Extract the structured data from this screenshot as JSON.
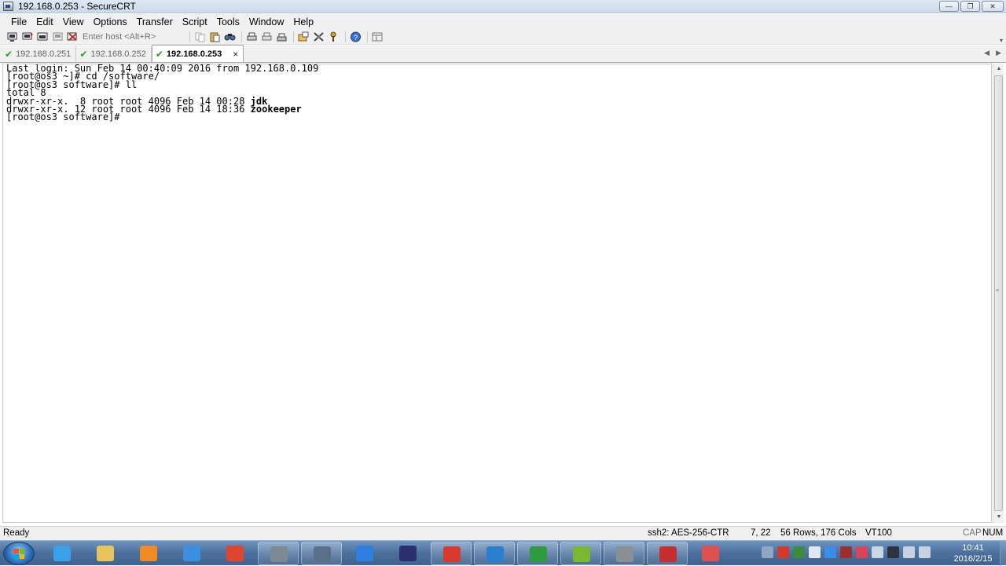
{
  "window": {
    "title": "192.168.0.253 - SecureCRT",
    "controls": {
      "minimize": "—",
      "maximize": "❐",
      "close": "✕"
    }
  },
  "menu": [
    "File",
    "Edit",
    "View",
    "Options",
    "Transfer",
    "Script",
    "Tools",
    "Window",
    "Help"
  ],
  "toolbar": {
    "host_placeholder": "Enter host <Alt+R>"
  },
  "tabs": [
    {
      "label": "192.168.0.251",
      "active": false
    },
    {
      "label": "192.168.0.252",
      "active": false
    },
    {
      "label": "192.168.0.253",
      "active": true,
      "close": "×"
    }
  ],
  "tab_arrows": {
    "left": "◀",
    "right": "▶"
  },
  "terminal": {
    "lines": [
      "Last login: Sun Feb 14 00:40:09 2016 from 192.168.0.109",
      "[root@os3 ~]# cd /software/",
      "[root@os3 software]# ll",
      "total 8"
    ],
    "listing": [
      {
        "prefix": "drwxr-xr-x.  8 root root 4096 Feb 14 00:28 ",
        "name": "jdk"
      },
      {
        "prefix": "drwxr-xr-x. 12 root root 4096 Feb 14 18:36 ",
        "name": "zookeeper"
      }
    ],
    "prompt": "[root@os3 software]# "
  },
  "status": {
    "ready": "Ready",
    "cipher": "ssh2: AES-256-CTR",
    "cursor": "7,  22",
    "size": "56 Rows, 176 Cols",
    "emulation": "VT100",
    "cap": "CAP",
    "num": "NUM"
  },
  "taskbar": {
    "clock_time": "10:41",
    "clock_date": "2016/2/15",
    "apps": [
      {
        "name": "internet-explorer",
        "color": "#3aa0e8",
        "open": false
      },
      {
        "name": "file-explorer",
        "color": "#e8c25a",
        "open": false
      },
      {
        "name": "media-player",
        "color": "#f08a24",
        "open": false
      },
      {
        "name": "baidu-cloud",
        "color": "#3c8fe0",
        "open": false
      },
      {
        "name": "chrome",
        "color": "#e0452f",
        "open": false
      },
      {
        "name": "explorer-window",
        "color": "#7d8a96",
        "open": true
      },
      {
        "name": "remote-tool",
        "color": "#5a6f88",
        "open": true
      },
      {
        "name": "feather-app",
        "color": "#2f7fe0",
        "open": false
      },
      {
        "name": "eclipse",
        "color": "#2b2f6e",
        "open": false
      },
      {
        "name": "red-app",
        "color": "#d83a2f",
        "open": true
      },
      {
        "name": "virtualbox",
        "color": "#2a7fd0",
        "open": true
      },
      {
        "name": "project-app",
        "color": "#2f9a3f",
        "open": true
      },
      {
        "name": "m-app",
        "color": "#7cb82f",
        "open": true
      },
      {
        "name": "securecrt",
        "color": "#8a8f96",
        "open": true
      },
      {
        "name": "pdf-app",
        "color": "#c62f2f",
        "open": true
      },
      {
        "name": "eraser-app",
        "color": "#e05050",
        "open": false
      }
    ]
  }
}
